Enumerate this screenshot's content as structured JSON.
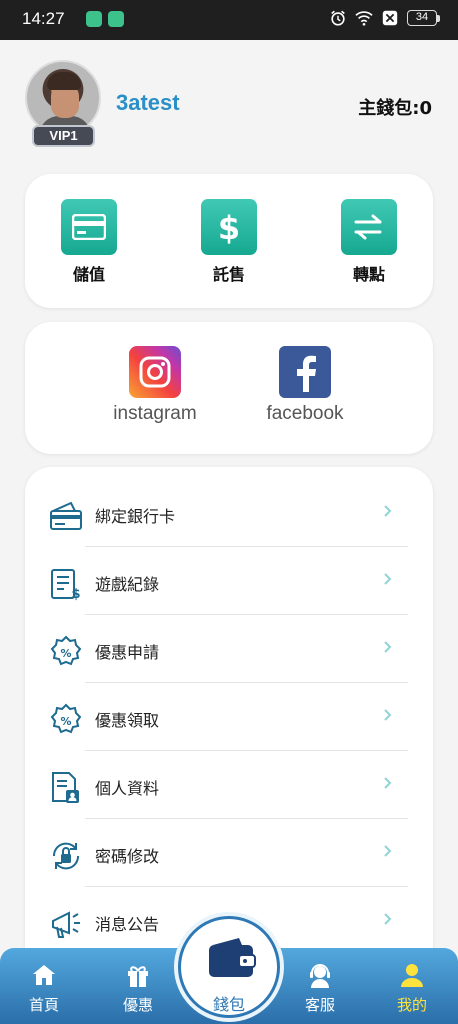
{
  "status_bar": {
    "time": "14:27",
    "battery": "34"
  },
  "profile": {
    "username": "3atest",
    "vip_label": "VIP1",
    "wallet_balance": "主錢包:0"
  },
  "actions": [
    {
      "label": "儲值",
      "icon": "card-icon"
    },
    {
      "label": "託售",
      "icon": "dollar-icon"
    },
    {
      "label": "轉點",
      "icon": "transfer-icon"
    }
  ],
  "social": [
    {
      "label": "instagram",
      "icon": "instagram-icon"
    },
    {
      "label": "facebook",
      "icon": "facebook-icon"
    }
  ],
  "menu": [
    {
      "label": "綁定銀行卡",
      "icon": "bank-card-icon"
    },
    {
      "label": "遊戲紀錄",
      "icon": "game-record-icon"
    },
    {
      "label": "優惠申請",
      "icon": "promo-apply-icon"
    },
    {
      "label": "優惠領取",
      "icon": "promo-claim-icon"
    },
    {
      "label": "個人資料",
      "icon": "profile-doc-icon"
    },
    {
      "label": "密碼修改",
      "icon": "password-lock-icon"
    },
    {
      "label": "消息公告",
      "icon": "announcement-icon"
    }
  ],
  "tabs": [
    {
      "label": "首頁",
      "icon": "home-icon"
    },
    {
      "label": "優惠",
      "icon": "gift-icon"
    },
    {
      "label": "錢包",
      "icon": "wallet-icon"
    },
    {
      "label": "客服",
      "icon": "support-icon"
    },
    {
      "label": "我的",
      "icon": "user-icon",
      "active": true
    }
  ],
  "colors": {
    "accent": "#2a8fc6",
    "action_teal": "#1fb39c",
    "menu_icon": "#1e6b8f",
    "tabbar": "#3b8fd0",
    "tab_active": "#ffe23d"
  }
}
